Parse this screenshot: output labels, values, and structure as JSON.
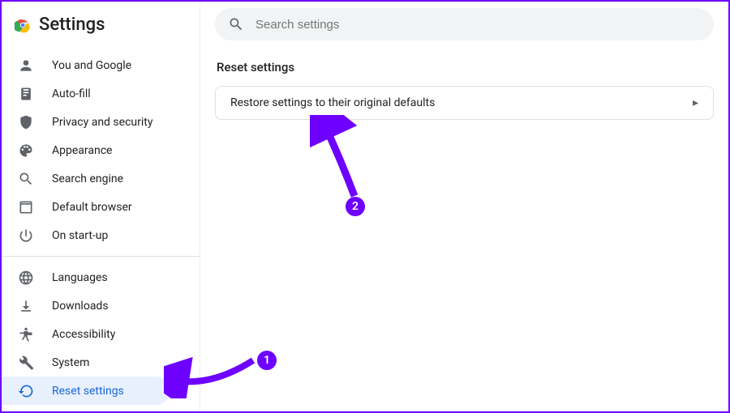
{
  "header": {
    "title": "Settings"
  },
  "search": {
    "placeholder": "Search settings"
  },
  "sidebar": {
    "groups": [
      [
        {
          "icon": "person",
          "label": "You and Google"
        },
        {
          "icon": "autofill",
          "label": "Auto-fill"
        },
        {
          "icon": "shield",
          "label": "Privacy and security"
        },
        {
          "icon": "palette",
          "label": "Appearance"
        },
        {
          "icon": "search",
          "label": "Search engine"
        },
        {
          "icon": "browser",
          "label": "Default browser"
        },
        {
          "icon": "power",
          "label": "On start-up"
        }
      ],
      [
        {
          "icon": "globe",
          "label": "Languages"
        },
        {
          "icon": "download",
          "label": "Downloads"
        },
        {
          "icon": "accessibility",
          "label": "Accessibility"
        },
        {
          "icon": "wrench",
          "label": "System"
        },
        {
          "icon": "reset",
          "label": "Reset settings",
          "active": true
        }
      ]
    ]
  },
  "main": {
    "section_title": "Reset settings",
    "rows": [
      {
        "label": "Restore settings to their original defaults"
      }
    ]
  },
  "annotations": {
    "badge1": "1",
    "badge2": "2",
    "accent": "#6e00ff"
  }
}
